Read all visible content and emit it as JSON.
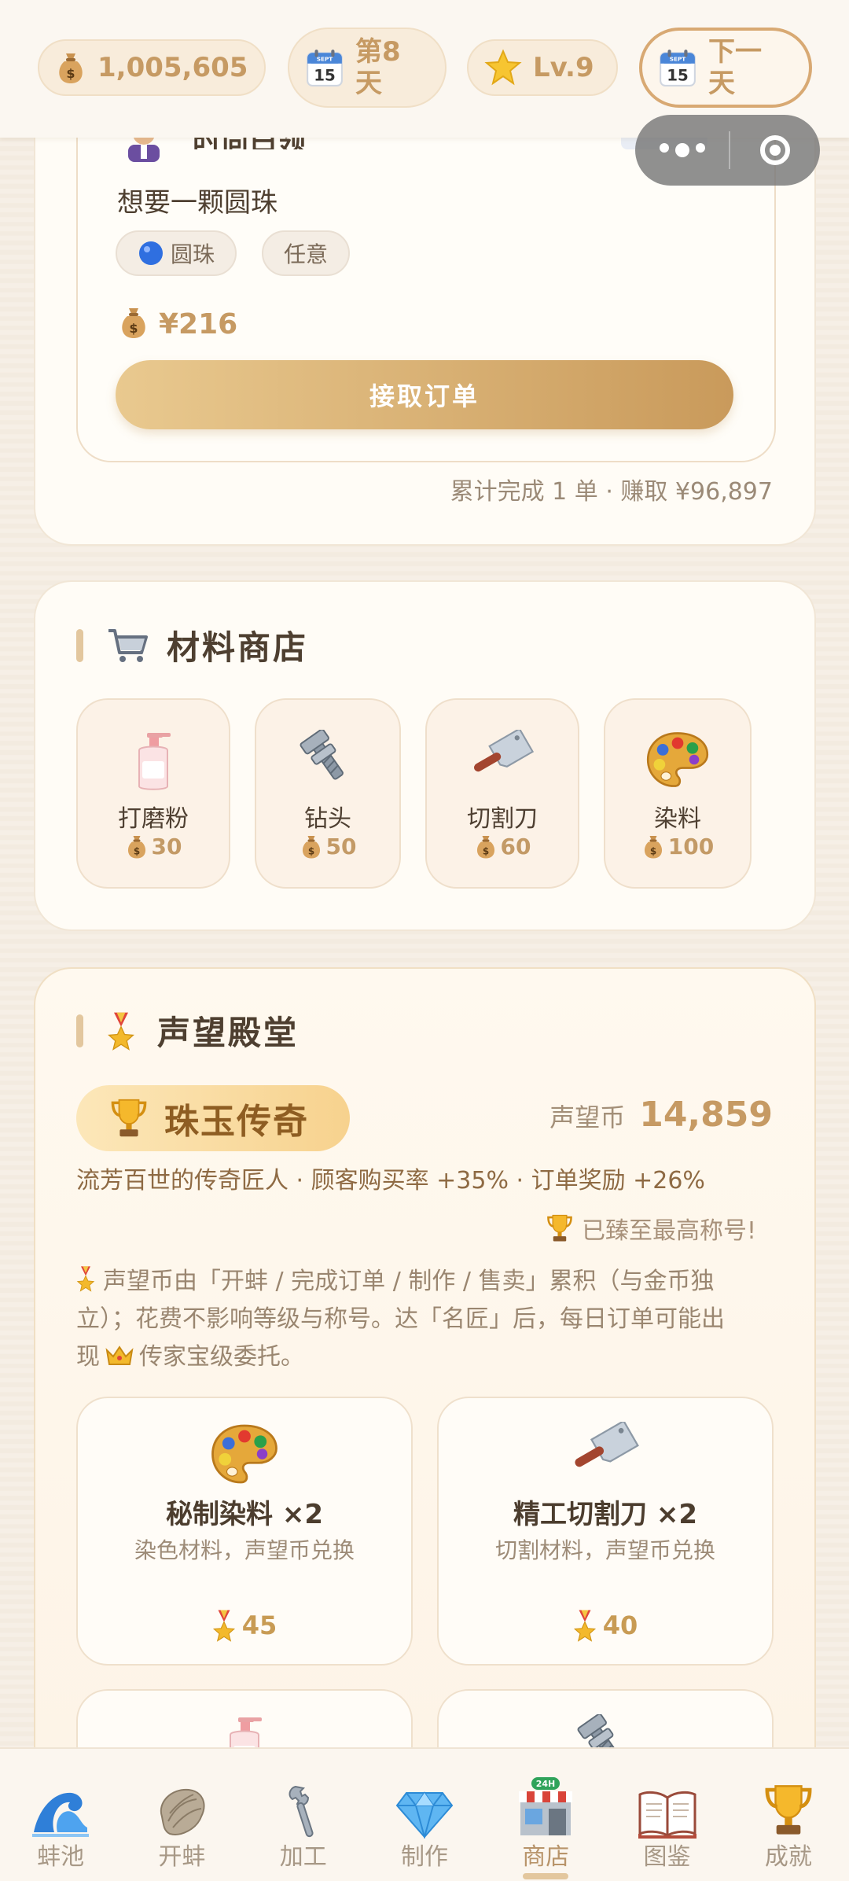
{
  "topbar": {
    "gold": "1,005,605",
    "calendar_month": "SEPT",
    "calendar_day": "15",
    "day_line1": "第8",
    "day_line2": "天",
    "level": "Lv.9",
    "next_line1": "下一",
    "next_line2": "天"
  },
  "order": {
    "partial_header": "时尚白领",
    "request": "想要一颗圆珠",
    "tags": [
      "圆珠",
      "任意"
    ],
    "reward": "¥216",
    "accept_button": "接取订单",
    "summary": "累计完成 1 单 · 赚取 ¥96,897"
  },
  "material_shop": {
    "title": "材料商店",
    "items": [
      {
        "name": "打磨粉",
        "price": "30",
        "icon": "lotion-bottle-icon"
      },
      {
        "name": "钻头",
        "price": "50",
        "icon": "nut-bolt-icon"
      },
      {
        "name": "切割刀",
        "price": "60",
        "icon": "cleaver-icon"
      },
      {
        "name": "染料",
        "price": "100",
        "icon": "palette-icon"
      }
    ]
  },
  "reputation_hall": {
    "title": "声望殿堂",
    "rank_title": "珠玉传奇",
    "currency_label": "声望币",
    "currency_value": "14,859",
    "perks": "流芳百世的传奇匠人 · 顾客购买率 +35% · 订单奖励 +26%",
    "max_note": "已臻至最高称号!",
    "info_line1": "声望币由「开蚌 / 完成订单 / 制作 / 售卖」累积（与金币独",
    "info_line2": "立）；花费不影响等级与称号。达「名匠」后，每日订单可能出",
    "info_line3_a": "现",
    "info_line3_b": "传家宝级委托。",
    "items": [
      {
        "name": "秘制染料 ×2",
        "desc": "染色材料，声望币兑换",
        "cost": "45",
        "icon": "palette-icon"
      },
      {
        "name": "精工切割刀 ×2",
        "desc": "切割材料，声望币兑换",
        "cost": "40",
        "icon": "cleaver-icon"
      }
    ]
  },
  "bottom_nav": [
    {
      "label": "蚌池",
      "icon": "wave-icon"
    },
    {
      "label": "开蚌",
      "icon": "oyster-icon"
    },
    {
      "label": "加工",
      "icon": "wrench-icon"
    },
    {
      "label": "制作",
      "icon": "diamond-icon"
    },
    {
      "label": "商店",
      "icon": "store-icon",
      "badge": "24H",
      "active": true
    },
    {
      "label": "图鉴",
      "icon": "book-icon"
    },
    {
      "label": "成就",
      "icon": "trophy-icon"
    }
  ],
  "colors": {
    "accent_gold": "#c69a63",
    "button_gradient_start": "#e9c98f",
    "button_gradient_end": "#c99a5b",
    "badge_text": "#8e5d22"
  }
}
